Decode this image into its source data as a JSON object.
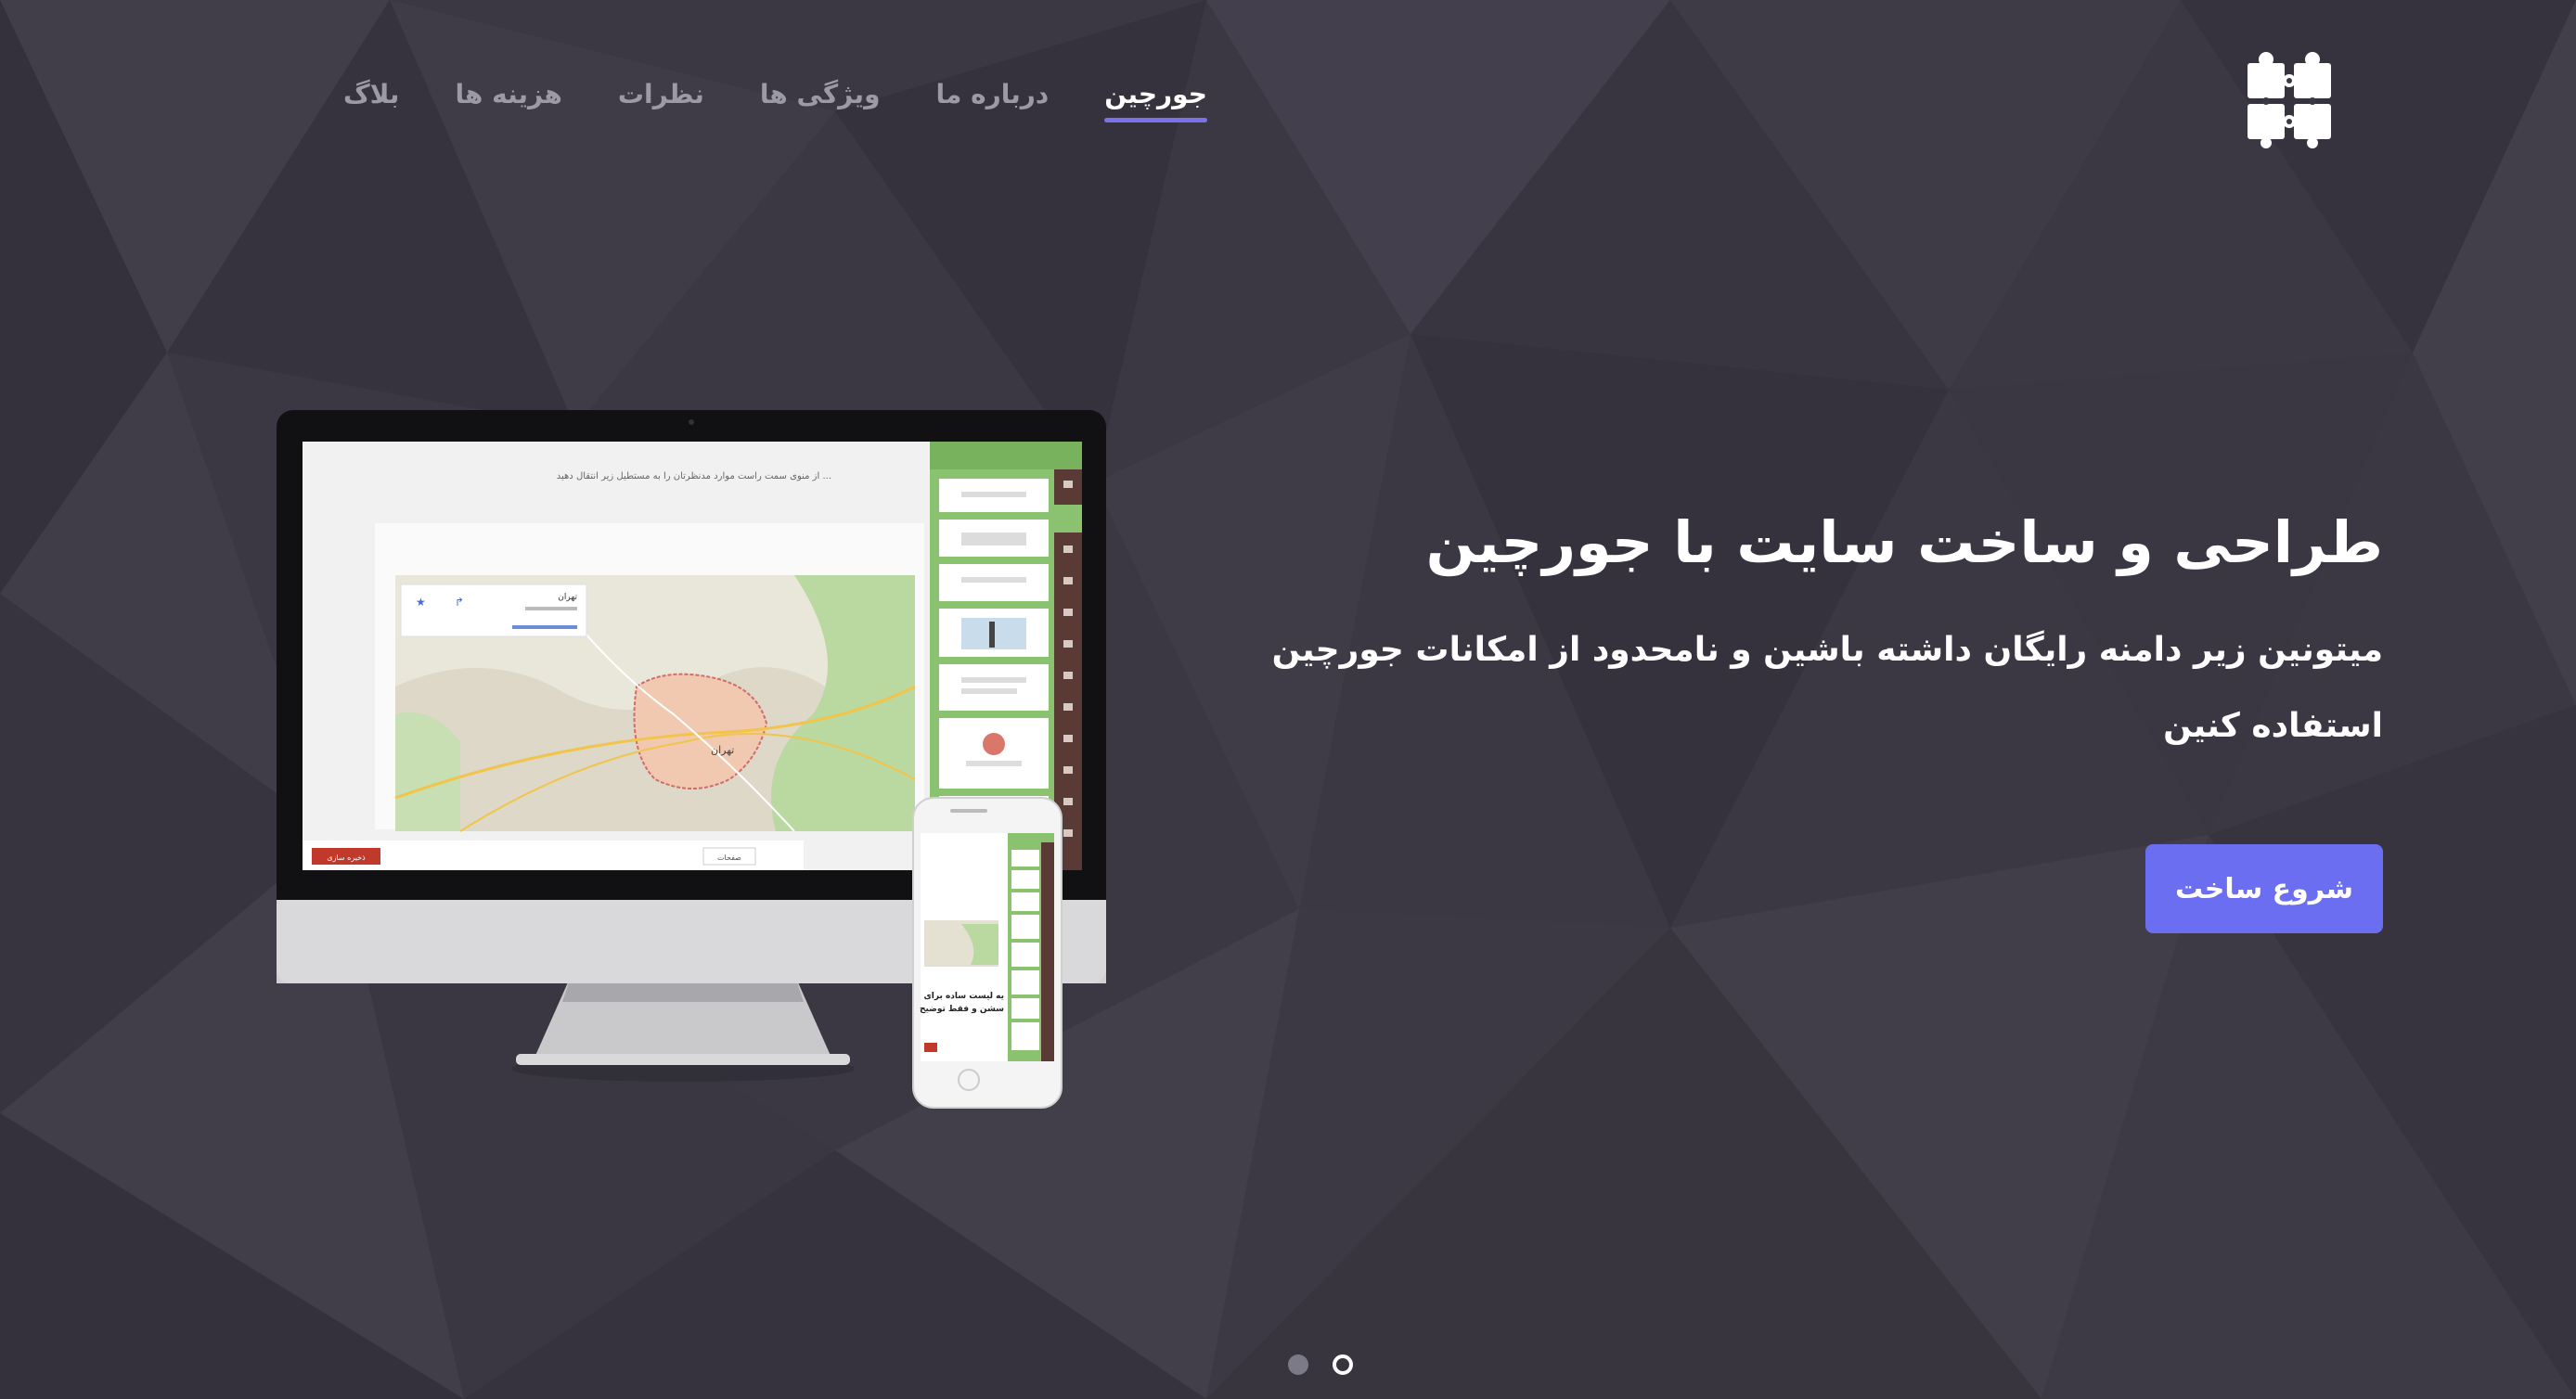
{
  "brand": {
    "logo_icon": "puzzle-pieces-icon"
  },
  "nav": {
    "items": [
      {
        "label": "جورچین",
        "active": true
      },
      {
        "label": "درباره ما",
        "active": false
      },
      {
        "label": "ویژگی ها",
        "active": false
      },
      {
        "label": "نظرات",
        "active": false
      },
      {
        "label": "هزینه ها",
        "active": false
      },
      {
        "label": "بلاگ",
        "active": false
      }
    ]
  },
  "hero": {
    "title": "طراحی و ساخت سایت با جورچین",
    "subtitle": "میتونین زیر دامنه رایگان داشته باشین و نامحدود از امکانات جورچین استفاده کنین",
    "cta_label": "شروع ساخت"
  },
  "mockup": {
    "editor_hint": "از منوی سمت راست موارد مدنظرتان را به مستطیل زیر انتقال دهید ...",
    "map_city": "تهران",
    "save_label": "ذخیره سازی",
    "pages_label": "صفحات",
    "phone_text_1": "یه لیست ساده برای",
    "phone_text_2": "سشن و فقط توضیح"
  },
  "carousel": {
    "total": 2,
    "active_index": 1
  },
  "colors": {
    "background": "#3b3844",
    "accent": "#6b6ef0",
    "editor_green": "#8bc26f",
    "nav_inactive": "#9c9aa6"
  }
}
